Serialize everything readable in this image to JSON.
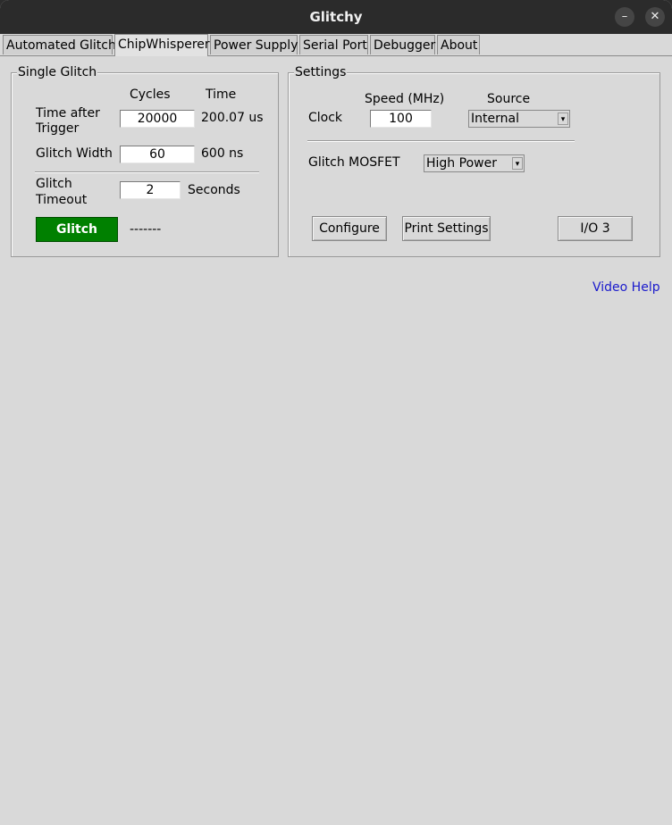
{
  "window": {
    "title": "Glitchy",
    "minimize": "–",
    "close": "✕"
  },
  "tabs": [
    {
      "label": "Automated Glitch"
    },
    {
      "label": "ChipWhisperer"
    },
    {
      "label": "Power Supply"
    },
    {
      "label": "Serial Port"
    },
    {
      "label": "Debugger"
    },
    {
      "label": "About"
    }
  ],
  "active_tab": "ChipWhisperer",
  "single_glitch": {
    "legend": "Single Glitch",
    "col_cycles": "Cycles",
    "col_time": "Time",
    "time_after_trigger_label_1": "Time after",
    "time_after_trigger_label_2": "Trigger",
    "time_after_trigger_cycles": "20000",
    "time_after_trigger_time": "200.07 us",
    "glitch_width_label": "Glitch Width",
    "glitch_width_cycles": "60",
    "glitch_width_time": "600 ns",
    "glitch_timeout_label_1": "Glitch",
    "glitch_timeout_label_2": "Timeout",
    "glitch_timeout_value": "2",
    "glitch_timeout_unit": "Seconds",
    "glitch_button": "Glitch",
    "status": "-------"
  },
  "settings": {
    "legend": "Settings",
    "speed_header": "Speed (MHz)",
    "source_header": "Source",
    "clock_label": "Clock",
    "clock_speed": "100",
    "clock_source": "Internal",
    "mosfet_label": "Glitch MOSFET",
    "mosfet_value": "High Power",
    "configure_button": "Configure",
    "print_settings_button": "Print Settings",
    "io_button": "I/O 3"
  },
  "video_help": "Video Help",
  "colors": {
    "glitch_button": "#008000",
    "link": "#1a1acc"
  }
}
